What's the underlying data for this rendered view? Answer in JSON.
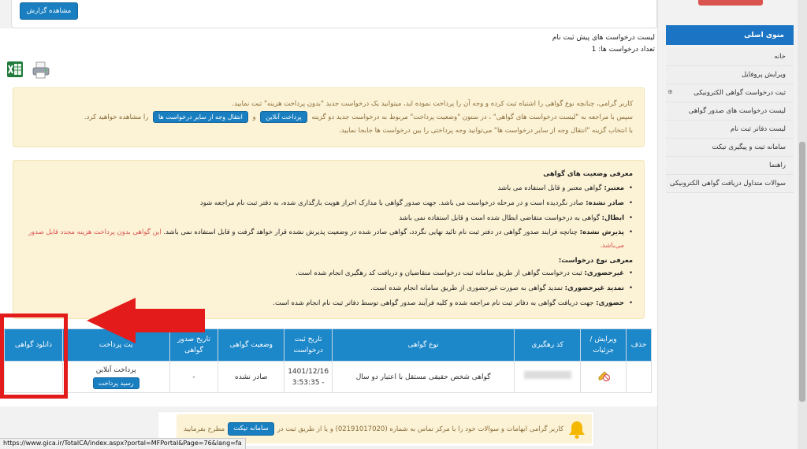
{
  "top_panel": {
    "report_button": "مشاهده گزارش"
  },
  "list": {
    "title": "لیست درخواست های پیش ثبت نام",
    "count_text": "تعداد درخواست ها: 1"
  },
  "toolbar_icons": [
    "excel-export-icon",
    "print-icon"
  ],
  "alert": {
    "line1": "کاربر گرامی، چنانچه نوع گواهی را اشتباه ثبت کرده و وجه آن را پرداخت نموده اید، میتوانید یک درخواست جدید \"بدون پرداخت هزینه\" ثبت نمایید.",
    "line2_part1": "سپس با مراجعه به \"لیست درخواست های گواهی\" ، در ستون \"وضعیت پرداخت\" مربوط به درخواست جدید دو گزینه",
    "online_pay_button": "پرداخت آنلاین",
    "line2_and": "و",
    "transfer_button": "انتقال وجه از سایر درخواست ها",
    "line2_part2": "را مشاهده خواهید کرد.",
    "line3": "با انتخاب گزینه \"انتقال وجه از سایر درخواست ها\" می‌توانید وجه پرداختی را بین درخواست ها جابجا نمایید."
  },
  "status_info": {
    "heading": "معرفی وضعیت های گواهی",
    "items": [
      {
        "term": "معتبر:",
        "text": " گواهی معتبر و قابل استفاده می باشد"
      },
      {
        "term": "صادر نشده:",
        "text": " صادر نگردیده است و در مرحله درخواست می باشد. جهت صدور گواهی با مدارک احراز هویت بارگذاری شده، به دفتر ثبت نام مراجعه شود"
      },
      {
        "term": "ابطال:",
        "text": " گواهی به درخواست متقاضی ابطال شده است و قابل استفاده نمی باشد"
      },
      {
        "term": "پذیرش نشده:",
        "text": " چنانچه فرایند صدور گواهی در دفتر ثبت نام تائید نهایی نگردد، گواهی صادر شده در وضعیت پذیرش نشده قرار خواهد گرفت و قابل استفاده نمی باشد.",
        "note": " این گواهی بدون پرداخت هزینه مجدد قابل صدور می‌باشد."
      }
    ],
    "type_heading": "معرفی نوع درخواست:",
    "type_items": [
      {
        "term": "غیرحضوری:",
        "text": " ثبت درخواست گواهی از طریق سامانه ثبت درخواست متقاضیان و دریافت کد رهگیری انجام شده است."
      },
      {
        "term": "تمدید غیرحضوری:",
        "text": " تمدید گواهی به صورت غیرحضوری از طریق سامانه انجام شده است."
      },
      {
        "term": "حضوری:",
        "text": " جهت دریافت گواهی به دفاتر ثبت نام مراجعه شده و کلیه فرآیند صدور گواهی توسط دفاتر ثبت نام انجام شده است."
      }
    ]
  },
  "table": {
    "headers": [
      "حذف",
      "ویرایش / جزئیات",
      "کد رهگیری",
      "نوع گواهی",
      "تاریخ ثبت درخواست",
      "وضعیت گواهی",
      "تاریخ صدور گواهی",
      "وضعیت پرداخت",
      "دانلود گواهی"
    ],
    "header_visible": [
      "حذف",
      "ویرایش / جزئیات",
      "کد رهگیری",
      "نوع گواهی",
      "تاریخ ثبت درخواست",
      "وضعیت گواهی",
      "تاریخ صدور گواهی",
      "یت پرداخت",
      "دانلود گواهی"
    ],
    "rows": [
      {
        "delete": "",
        "edit_icon": "edit-cancel-icon",
        "tracking_code": "",
        "cert_type": "گواهی شخص حقیقی مستقل با اعتبار دو سال",
        "request_date": "1401/12/16 - 3:53:35",
        "cert_status": "صادر نشده",
        "issue_date": "-",
        "payment_status": "پرداخت آنلاین",
        "receipt_button": "رسید پرداخت",
        "download": ""
      }
    ]
  },
  "sidebar": {
    "header": "منوی اصلی",
    "items": [
      "خانه",
      "ویرایش پروفایل",
      "ثبت درخواست گواهی الکترونیکی",
      "لیست درخواست های صدور گواهی",
      "لیست دفاتر ثبت نام",
      "سامانه ثبت و پیگیری تیکت",
      "راهنما",
      "سوالات متداول دریافت گواهی الکترونیکی"
    ]
  },
  "footer": {
    "text_part1": "کاربر گرامی ابهامات و سوالات خود را با مرکز تماس به شماره (02191017020) و یا از طریق ثبت در",
    "ticket_button": "سامانه تیکت",
    "text_part2": "مطرح بفرمایید"
  },
  "status_bar_url": "https://www.gica.ir/TotalCA/index.aspx?portal=MFPortal&Page=76&lang=fa",
  "colors": {
    "primary": "#1c87c9",
    "alert_bg": "#fcf3d6",
    "alert_text": "#8a6d3b",
    "annotation_red": "#e41b1b"
  }
}
